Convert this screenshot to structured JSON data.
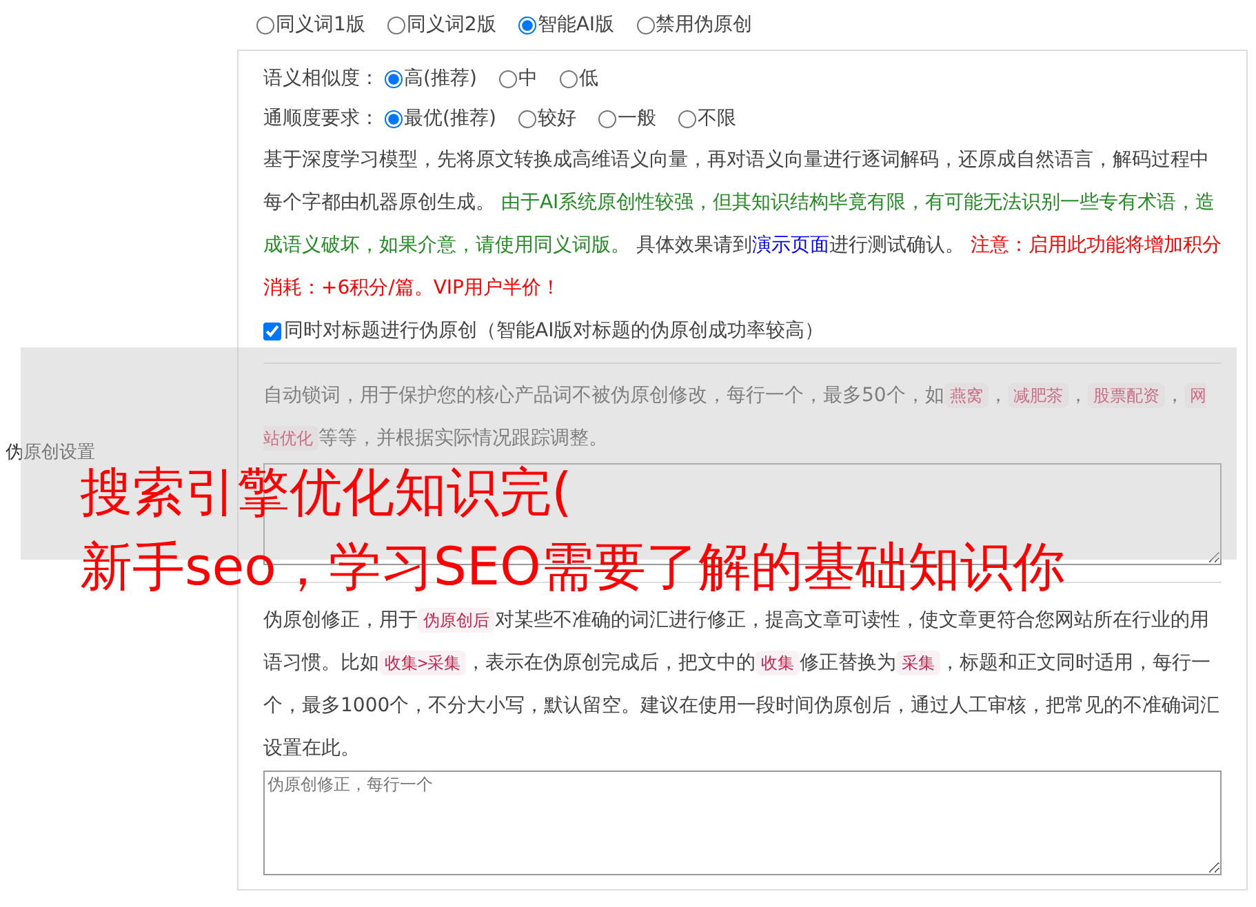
{
  "side_label": "伪原创设置",
  "mode_options": [
    {
      "label": "同义词1版",
      "selected": false
    },
    {
      "label": "同义词2版",
      "selected": false
    },
    {
      "label": "智能AI版",
      "selected": true
    },
    {
      "label": "禁用伪原创",
      "selected": false
    }
  ],
  "similarity": {
    "label": "语义相似度：",
    "options": [
      {
        "label": "高(推荐)",
        "selected": true
      },
      {
        "label": "中",
        "selected": false
      },
      {
        "label": "低",
        "selected": false
      }
    ]
  },
  "fluency": {
    "label": "通顺度要求：",
    "options": [
      {
        "label": "最优(推荐)",
        "selected": true
      },
      {
        "label": "较好",
        "selected": false
      },
      {
        "label": "一般",
        "selected": false
      },
      {
        "label": "不限",
        "selected": false
      }
    ]
  },
  "ai_description": [
    {
      "kind": "text",
      "text": "基于深度学习模型，先将原文转换成高维语义向量，再对语义向量进行逐词解码，还原成自然语言，解码过程中每个字都由机器原创生成。 "
    },
    {
      "kind": "notice",
      "text": "由于AI系统原创性较强，但其知识结构毕竟有限，有可能无法识别一些专有术语，造成语义破坏，如果介意，请使用同义词版。"
    },
    {
      "kind": "text",
      "text": " 具体效果请到"
    },
    {
      "kind": "link",
      "text": "演示页面"
    },
    {
      "kind": "text",
      "text": "进行测试确认。 "
    },
    {
      "kind": "warning",
      "text": "注意：启用此功能将增加积分消耗：+6积分/篇。VIP用户半价！"
    }
  ],
  "title_option": {
    "label": "同时对标题进行伪原创（智能AI版对标题的伪原创成功率较高）",
    "checked": true
  },
  "lock_words": {
    "description": [
      {
        "kind": "text",
        "text": "自动锁词，用于保护您的核心产品词不被伪原创修改，每行一个，最多50个，如"
      },
      {
        "kind": "tag",
        "text": "燕窝"
      },
      {
        "kind": "text",
        "text": "，"
      },
      {
        "kind": "tag",
        "text": "减肥茶"
      },
      {
        "kind": "text",
        "text": "，"
      },
      {
        "kind": "tag",
        "text": "股票配资"
      },
      {
        "kind": "text",
        "text": "，"
      },
      {
        "kind": "tag",
        "text": "网站优化"
      },
      {
        "kind": "text",
        "text": "等等，并根据实际情况跟踪调整。"
      }
    ]
  },
  "correction": {
    "description": [
      {
        "kind": "text",
        "text": "伪原创修正，用于"
      },
      {
        "kind": "tag",
        "text": "伪原创后"
      },
      {
        "kind": "text",
        "text": "对某些不准确的词汇进行修正，提高文章可读性，使文章更符合您网站所在行业的用语习惯。比如"
      },
      {
        "kind": "tag",
        "text": "收集>采集"
      },
      {
        "kind": "text",
        "text": "，表示在伪原创完成后，把文中的"
      },
      {
        "kind": "tag",
        "text": "收集"
      },
      {
        "kind": "text",
        "text": "修正替换为"
      },
      {
        "kind": "tag",
        "text": "采集"
      },
      {
        "kind": "text",
        "text": "，标题和正文同时适用，每行一个，最多1000个，不分大小写，默认留空。建议在使用一段时间伪原创后，通过人工审核，把常见的不准确词汇设置在此。"
      }
    ],
    "placeholder": "伪原创修正，每行一个"
  },
  "overlay": {
    "lines": [
      "搜索引擎优化知识完(",
      "新手seo，学习SEO需要了解的基础知识你"
    ]
  }
}
